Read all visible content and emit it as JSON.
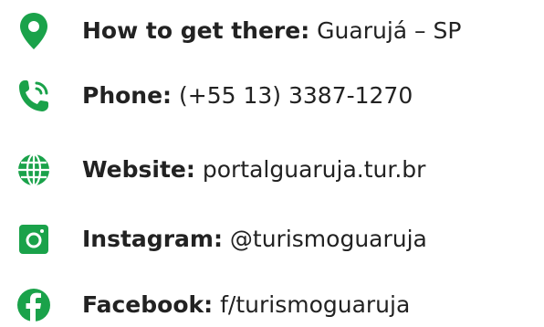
{
  "theme": {
    "accent": "#1aa24a",
    "text": "#222222"
  },
  "items": [
    {
      "icon": "location-pin-icon",
      "label": "How to get there:",
      "value": "Guarujá – SP"
    },
    {
      "icon": "phone-icon",
      "label": "Phone:",
      "value": " (+55 13) 3387-1270"
    },
    {
      "icon": "globe-icon",
      "label": "Website:",
      "value": " portalguaruja.tur.br"
    },
    {
      "icon": "instagram-icon",
      "label": "Instagram:",
      "value": "@turismoguaruja"
    },
    {
      "icon": "facebook-icon",
      "label": "Facebook:",
      "value": "f/turismoguaruja"
    }
  ]
}
